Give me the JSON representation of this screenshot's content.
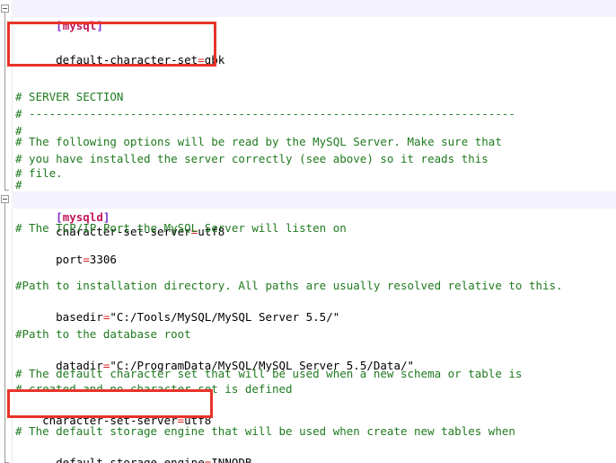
{
  "editor": {
    "app_type": "text-editor",
    "file_kind": "mysql-ini-config",
    "colors": {
      "comment": "#1f7a1f",
      "bracket": "#7a2ccc",
      "section_name": "#c2185b",
      "equals": "#d42020",
      "text": "#000000",
      "section_line_background": "#f4f2fd",
      "annotation_red": "#e8332a",
      "gutter_line": "#9a9a9a"
    }
  },
  "annotations": [
    {
      "id": "annotation-box-1",
      "target": "default-character-set=gbk"
    },
    {
      "id": "annotation-box-2",
      "target": "character-set-server=utf8"
    }
  ],
  "lines": [
    {
      "n": 1,
      "type": "section",
      "open": "[",
      "name": "mysql",
      "close": "]"
    },
    {
      "n": 2,
      "type": "blank",
      "text": ""
    },
    {
      "n": 3,
      "type": "setting",
      "key": "default-character-set",
      "eq": "=",
      "value": "gbk"
    },
    {
      "n": 4,
      "type": "blank",
      "text": ""
    },
    {
      "n": 5,
      "type": "blank",
      "text": ""
    },
    {
      "n": 6,
      "type": "comment",
      "text": "# SERVER SECTION"
    },
    {
      "n": 7,
      "type": "comment",
      "text": "# ------------------------------------------------------------------------"
    },
    {
      "n": 8,
      "type": "comment",
      "text": "#"
    },
    {
      "n": 9,
      "type": "comment",
      "text": "# The following options will be read by the MySQL Server. Make sure that"
    },
    {
      "n": 10,
      "type": "comment",
      "text": "# you have installed the server correctly (see above) so it reads this"
    },
    {
      "n": 11,
      "type": "comment",
      "text": "# file."
    },
    {
      "n": 12,
      "type": "comment",
      "text": "#"
    },
    {
      "n": 13,
      "type": "section",
      "open": "[",
      "name": "mysqld",
      "close": "]"
    },
    {
      "n": 14,
      "type": "setting",
      "key": "character-set-server",
      "eq": "=",
      "value": "utf8"
    },
    {
      "n": 15,
      "type": "comment",
      "text": "# The TCP/IP Port the MySQL Server will listen on"
    },
    {
      "n": 16,
      "type": "setting",
      "key": "port",
      "eq": "=",
      "value": "3306"
    },
    {
      "n": 17,
      "type": "blank",
      "text": ""
    },
    {
      "n": 18,
      "type": "blank",
      "text": ""
    },
    {
      "n": 19,
      "type": "comment",
      "text": "#Path to installation directory. All paths are usually resolved relative to this."
    },
    {
      "n": 20,
      "type": "setting",
      "key": "basedir",
      "eq": "=",
      "value": "\"C:/Tools/MySQL/MySQL Server 5.5/\""
    },
    {
      "n": 21,
      "type": "blank",
      "text": ""
    },
    {
      "n": 22,
      "type": "comment",
      "text": "#Path to the database root"
    },
    {
      "n": 23,
      "type": "setting",
      "key": "datadir",
      "eq": "=",
      "value": "\"C:/ProgramData/MySQL/MySQL Server 5.5/Data/\""
    },
    {
      "n": 24,
      "type": "blank",
      "text": ""
    },
    {
      "n": 25,
      "type": "comment",
      "text": "# The default character set that will be used when a new schema or table is"
    },
    {
      "n": 26,
      "type": "comment",
      "text": "# created and no character set is defined"
    },
    {
      "n": 27,
      "type": "setting",
      "key": "character-set-server",
      "eq": "=",
      "value": "utf8"
    },
    {
      "n": 28,
      "type": "blank",
      "text": ""
    },
    {
      "n": 29,
      "type": "comment",
      "text": "# The default storage engine that will be used when create new tables when"
    },
    {
      "n": 30,
      "type": "setting",
      "key": "default-storage-engine",
      "eq": "=",
      "value": "INNODB"
    }
  ]
}
